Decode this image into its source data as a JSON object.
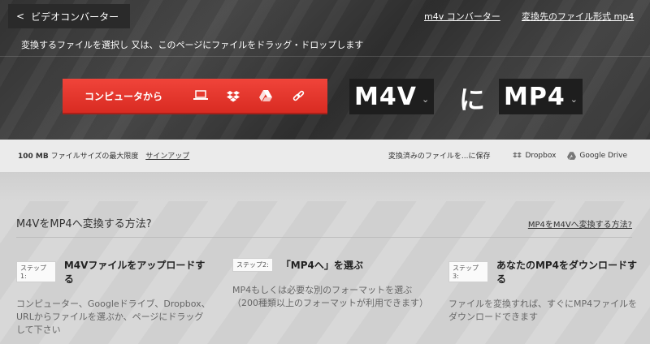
{
  "header": {
    "back_label": "ビデオコンバーター",
    "links": [
      "m4v コンバーター",
      "変換先のファイル形式 mp4"
    ],
    "instruction": "変換するファイルを選択し 又は、このページにファイルをドラッグ・ドロップします"
  },
  "upload": {
    "button_label": "コンピュータから",
    "sources": [
      "computer-icon",
      "dropbox-icon",
      "google-drive-icon",
      "url-link-icon"
    ],
    "from_format": "M4V",
    "connector": "に",
    "to_format": "MP4"
  },
  "infobar": {
    "size_limit": "100 MB",
    "size_text": "ファイルサイズの最大限度",
    "signup": "サインアップ",
    "save_text": "変換済みのファイルを...に保存",
    "dropbox": "Dropbox",
    "gdrive": "Google Drive"
  },
  "howto": {
    "title": "M4VをMP4へ変換する方法?",
    "reverse_link": "MP4をM4Vへ変換する方法?",
    "steps": [
      {
        "badge": "ステップ1:",
        "title": "M4Vファイルをアップロードする",
        "desc": "コンピューター、Googleドライブ、Dropbox、URLからファイルを選ぶか、ページにドラッグして下さい"
      },
      {
        "badge": "ステップ2:",
        "title": "「MP4へ」を選ぶ",
        "desc": "MP4もしくは必要な別のフォーマットを選ぶ（200種類以上のフォーマットが利用できます）"
      },
      {
        "badge": "ステップ3:",
        "title": "あなたのMP4をダウンロードする",
        "desc": "ファイルを変換すれば、すぐにMP4ファイルをダウンロードできます"
      }
    ]
  },
  "colors": {
    "accent_red": "#e8342b",
    "dark_bg": "#3a3a3a",
    "format_box": "#1e1e1e"
  }
}
